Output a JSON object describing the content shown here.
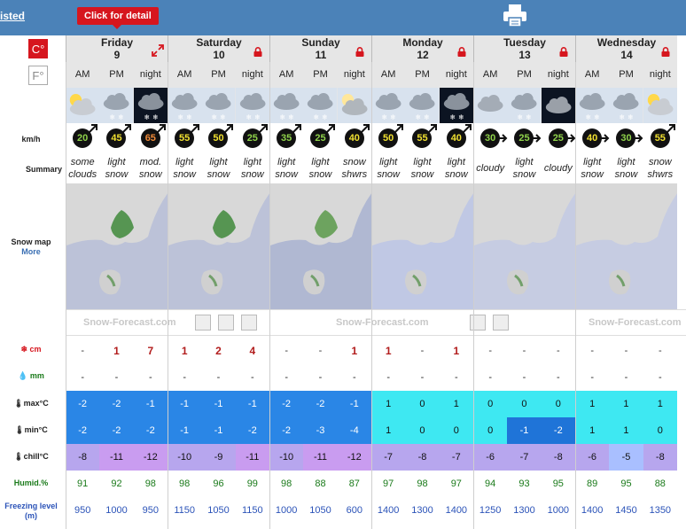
{
  "header": {
    "listed_link": "isted",
    "tooltip": "Click for detail"
  },
  "units": {
    "celsius": "C°",
    "fahrenheit": "F°"
  },
  "row_labels": {
    "wind": "km/h",
    "summary": "Summary",
    "snow_map": "Snow map",
    "more": "More",
    "snow": "cm",
    "rain": "mm",
    "max": "max°C",
    "min": "min°C",
    "chill": "chill°C",
    "humid": "Humid.%",
    "freezing": "Freezing level (m)"
  },
  "brand_text": "Snow-Forecast.com",
  "days": [
    {
      "name": "Friday",
      "num": "9",
      "icon": "expand-icon"
    },
    {
      "name": "Saturday",
      "num": "10",
      "icon": "lock-icon"
    },
    {
      "name": "Sunday",
      "num": "11",
      "icon": "lock-icon"
    },
    {
      "name": "Monday",
      "num": "12",
      "icon": "lock-icon"
    },
    {
      "name": "Tuesday",
      "num": "13",
      "icon": "lock-icon"
    },
    {
      "name": "Wednesday",
      "num": "14",
      "icon": "lock-icon"
    }
  ],
  "periods": [
    "AM",
    "PM",
    "night",
    "AM",
    "PM",
    "night",
    "AM",
    "PM",
    "night",
    "AM",
    "PM",
    "night",
    "AM",
    "PM",
    "night",
    "AM",
    "PM",
    "night"
  ],
  "weather_icons": [
    "sun-cloud",
    "snow-cloud",
    "night-snow",
    "snow-cloud",
    "snow-cloud",
    "snow-cloud",
    "snow-cloud",
    "snow-cloud",
    "moon-cloud",
    "snow-cloud",
    "snow-cloud",
    "night-snow",
    "cloud",
    "snow-cloud",
    "night-cloud",
    "snow-cloud",
    "snow-cloud",
    "sun-cloud"
  ],
  "wind": [
    {
      "v": "20",
      "c": "#8fd24a",
      "dir": "up"
    },
    {
      "v": "45",
      "c": "#f0e030",
      "dir": "up"
    },
    {
      "v": "65",
      "c": "#f08a38",
      "dir": "up"
    },
    {
      "v": "55",
      "c": "#f0e030",
      "dir": "up"
    },
    {
      "v": "50",
      "c": "#f0e030",
      "dir": "up"
    },
    {
      "v": "25",
      "c": "#8fd24a",
      "dir": "up"
    },
    {
      "v": "35",
      "c": "#8fd24a",
      "dir": "up"
    },
    {
      "v": "25",
      "c": "#8fd24a",
      "dir": "up"
    },
    {
      "v": "40",
      "c": "#f0e030",
      "dir": "up"
    },
    {
      "v": "50",
      "c": "#f0e030",
      "dir": "up"
    },
    {
      "v": "55",
      "c": "#f0e030",
      "dir": "up"
    },
    {
      "v": "40",
      "c": "#f0e030",
      "dir": "up"
    },
    {
      "v": "30",
      "c": "#8fd24a",
      "dir": "right"
    },
    {
      "v": "25",
      "c": "#8fd24a",
      "dir": "right"
    },
    {
      "v": "25",
      "c": "#8fd24a",
      "dir": "right"
    },
    {
      "v": "40",
      "c": "#f0e030",
      "dir": "right"
    },
    {
      "v": "30",
      "c": "#8fd24a",
      "dir": "right"
    },
    {
      "v": "55",
      "c": "#f0e030",
      "dir": "up"
    }
  ],
  "summary": [
    "some clouds",
    "light snow",
    "mod. snow",
    "light snow",
    "light snow",
    "light snow",
    "light snow",
    "light snow",
    "snow shwrs",
    "light snow",
    "light snow",
    "light snow",
    "cloudy",
    "light snow",
    "cloudy",
    "light snow",
    "light snow",
    "snow shwrs"
  ],
  "snow_cm": [
    "-",
    "1",
    "7",
    "1",
    "2",
    "4",
    "-",
    "-",
    "1",
    "1",
    "-",
    "1",
    "-",
    "-",
    "-",
    "-",
    "-",
    "-"
  ],
  "rain_mm": [
    "-",
    "-",
    "-",
    "-",
    "-",
    "-",
    "-",
    "-",
    "-",
    "-",
    "-",
    "-",
    "-",
    "-",
    "-",
    "-",
    "-",
    "-"
  ],
  "max_c": [
    "-2",
    "-2",
    "-1",
    "-1",
    "-1",
    "-1",
    "-2",
    "-2",
    "-1",
    "1",
    "0",
    "1",
    "0",
    "0",
    "0",
    "1",
    "1",
    "1"
  ],
  "min_c": [
    "-2",
    "-2",
    "-2",
    "-1",
    "-1",
    "-2",
    "-2",
    "-3",
    "-4",
    "1",
    "0",
    "0",
    "0",
    "-1",
    "-2",
    "1",
    "1",
    "0"
  ],
  "chill_c": [
    "-8",
    "-11",
    "-12",
    "-10",
    "-9",
    "-11",
    "-10",
    "-11",
    "-12",
    "-7",
    "-8",
    "-7",
    "-6",
    "-7",
    "-8",
    "-6",
    "-5",
    "-8"
  ],
  "humid": [
    "91",
    "92",
    "98",
    "98",
    "96",
    "99",
    "98",
    "88",
    "87",
    "97",
    "98",
    "97",
    "94",
    "93",
    "95",
    "89",
    "95",
    "88"
  ],
  "freezing": [
    "950",
    "1000",
    "950",
    "1150",
    "1050",
    "1150",
    "1000",
    "1050",
    "600",
    "1400",
    "1300",
    "1400",
    "1250",
    "1300",
    "1000",
    "1400",
    "1450",
    "1350"
  ],
  "colors": {
    "neg_blue": "#2a86e6",
    "dark_blue": "#1f74d8",
    "pos_cyan": "#3ee8f2",
    "chill_lav": "#b7a6ee",
    "chill_purple": "#c99cf0",
    "chill_light": "#a9bfff"
  }
}
